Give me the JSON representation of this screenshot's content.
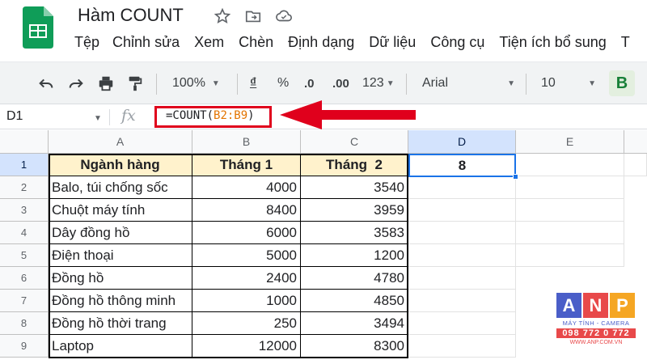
{
  "doc": {
    "title": "Hàm COUNT"
  },
  "menu": [
    "Tệp",
    "Chỉnh sửa",
    "Xem",
    "Chèn",
    "Định dạng",
    "Dữ liệu",
    "Công cụ",
    "Tiện ích bổ sung",
    "T"
  ],
  "toolbar": {
    "zoom": "100%",
    "currency": "₫",
    "percent": "%",
    "dec_less": ".0",
    "dec_more": ".00",
    "format_more": "123",
    "font": "Arial",
    "font_size": "10",
    "bold": "B"
  },
  "formula_bar": {
    "cell_ref": "D1",
    "fx": "fx",
    "prefix": "=COUNT(",
    "range": "B2:B9",
    "suffix": ")"
  },
  "columns": [
    "A",
    "B",
    "C",
    "D",
    "E"
  ],
  "rows": [
    1,
    2,
    3,
    4,
    5,
    6,
    7,
    8,
    9
  ],
  "table": {
    "headers": [
      "Ngành hàng",
      "Tháng 1",
      "Tháng  2"
    ],
    "data": [
      [
        "Balo, túi chống sốc",
        "4000",
        "3540"
      ],
      [
        "Chuột máy tính",
        "8400",
        "3959"
      ],
      [
        "Dây đồng hồ",
        "6000",
        "3583"
      ],
      [
        "Điện thoại",
        "5000",
        "1200"
      ],
      [
        "Đồng hồ",
        "2400",
        "4780"
      ],
      [
        "Đồng hồ thông minh",
        "1000",
        "4850"
      ],
      [
        "Đồng hồ thời trang",
        "250",
        "3494"
      ],
      [
        "Laptop",
        "12000",
        "8300"
      ]
    ]
  },
  "result": {
    "cell": "D1",
    "value": "8"
  },
  "watermark": {
    "letters": [
      "A",
      "N",
      "P"
    ],
    "tagline": "MÁY TÍNH - CAMERA",
    "phone": "098 772 0 772",
    "website": "WWW.ANP.COM.VN"
  },
  "colors": {
    "accent": "#e0001c",
    "selection": "#1a73e8",
    "header_fill": "#fff2cc",
    "sheets_green": "#0f9d58"
  }
}
